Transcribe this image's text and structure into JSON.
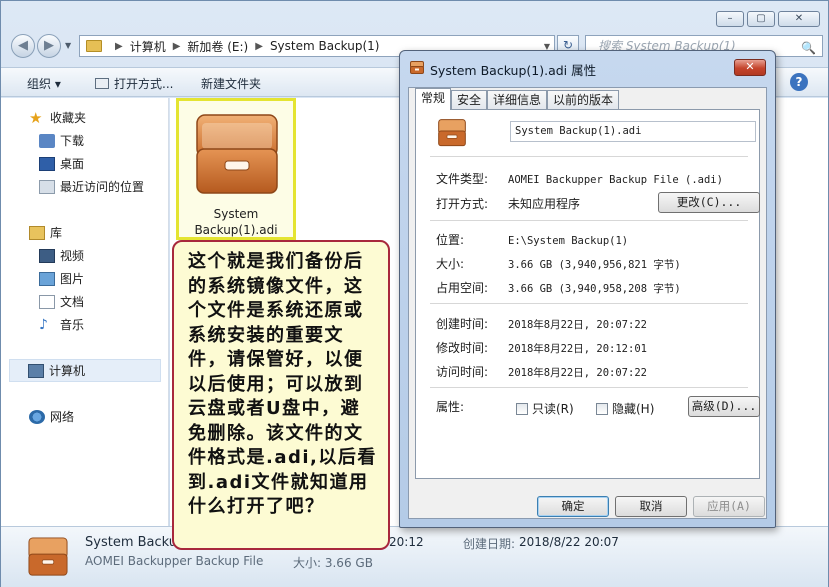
{
  "window": {
    "controls": [
      "–",
      "▢",
      "✕"
    ]
  },
  "nav": {
    "back_icon": "back-arrow-icon",
    "forward_icon": "forward-arrow-icon",
    "breadcrumb": [
      "计算机",
      "新加卷 (E:)",
      "System Backup(1)"
    ],
    "search_placeholder": "搜索 System Backup(1)"
  },
  "toolbar": {
    "organize": "组织 ▾",
    "open_with": "打开方式...",
    "new_folder": "新建文件夹"
  },
  "sidebar": {
    "favorites": {
      "label": "收藏夹",
      "items": [
        "下载",
        "桌面",
        "最近访问的位置"
      ]
    },
    "libraries": {
      "label": "库",
      "items": [
        "视频",
        "图片",
        "文档",
        "音乐"
      ]
    },
    "computer": "计算机",
    "network": "网络"
  },
  "file": {
    "name_line1": "System",
    "name_line2": "Backup(1).adi"
  },
  "status": {
    "name": "System Backup",
    "type": "AOMEI Backupper Backup File",
    "modified_partial": "20:12",
    "created_label": "创建日期:",
    "created_value": "2018/8/22 20:07",
    "size": "大小: 3.66 GB"
  },
  "dialog": {
    "title": "System Backup(1).adi 属性",
    "close": "✕",
    "tabs": [
      "常规",
      "安全",
      "详细信息",
      "以前的版本"
    ],
    "filename": "System Backup(1).adi",
    "type_label": "文件类型:",
    "type_value": "AOMEI Backupper Backup File (.adi)",
    "openwith_label": "打开方式:",
    "openwith_value": "未知应用程序",
    "change_button": "更改(C)...",
    "location_label": "位置:",
    "location_value": "E:\\System Backup(1)",
    "size_label": "大小:",
    "size_value": "3.66 GB (3,940,956,821 字节)",
    "disk_label": "占用空间:",
    "disk_value": "3.66 GB (3,940,958,208 字节)",
    "created_label": "创建时间:",
    "created_value": "2018年8月22日, 20:07:22",
    "modified_label": "修改时间:",
    "modified_value": "2018年8月22日, 20:12:01",
    "accessed_label": "访问时间:",
    "accessed_value": "2018年8月22日, 20:07:22",
    "attrs_label": "属性:",
    "readonly": "只读(R)",
    "hidden": "隐藏(H)",
    "advanced_button": "高级(D)...",
    "ok": "确定",
    "cancel": "取消",
    "apply": "应用(A)"
  },
  "callout": {
    "text": "这个就是我们备份后的系统镜像文件，这个文件是系统还原或系统安装的重要文件，请保管好，以便以后使用；可以放到云盘或者U盘中，避免删除。该文件的文件格式是.adi,以后看到.adi文件就知道用什么打开了吧？"
  }
}
